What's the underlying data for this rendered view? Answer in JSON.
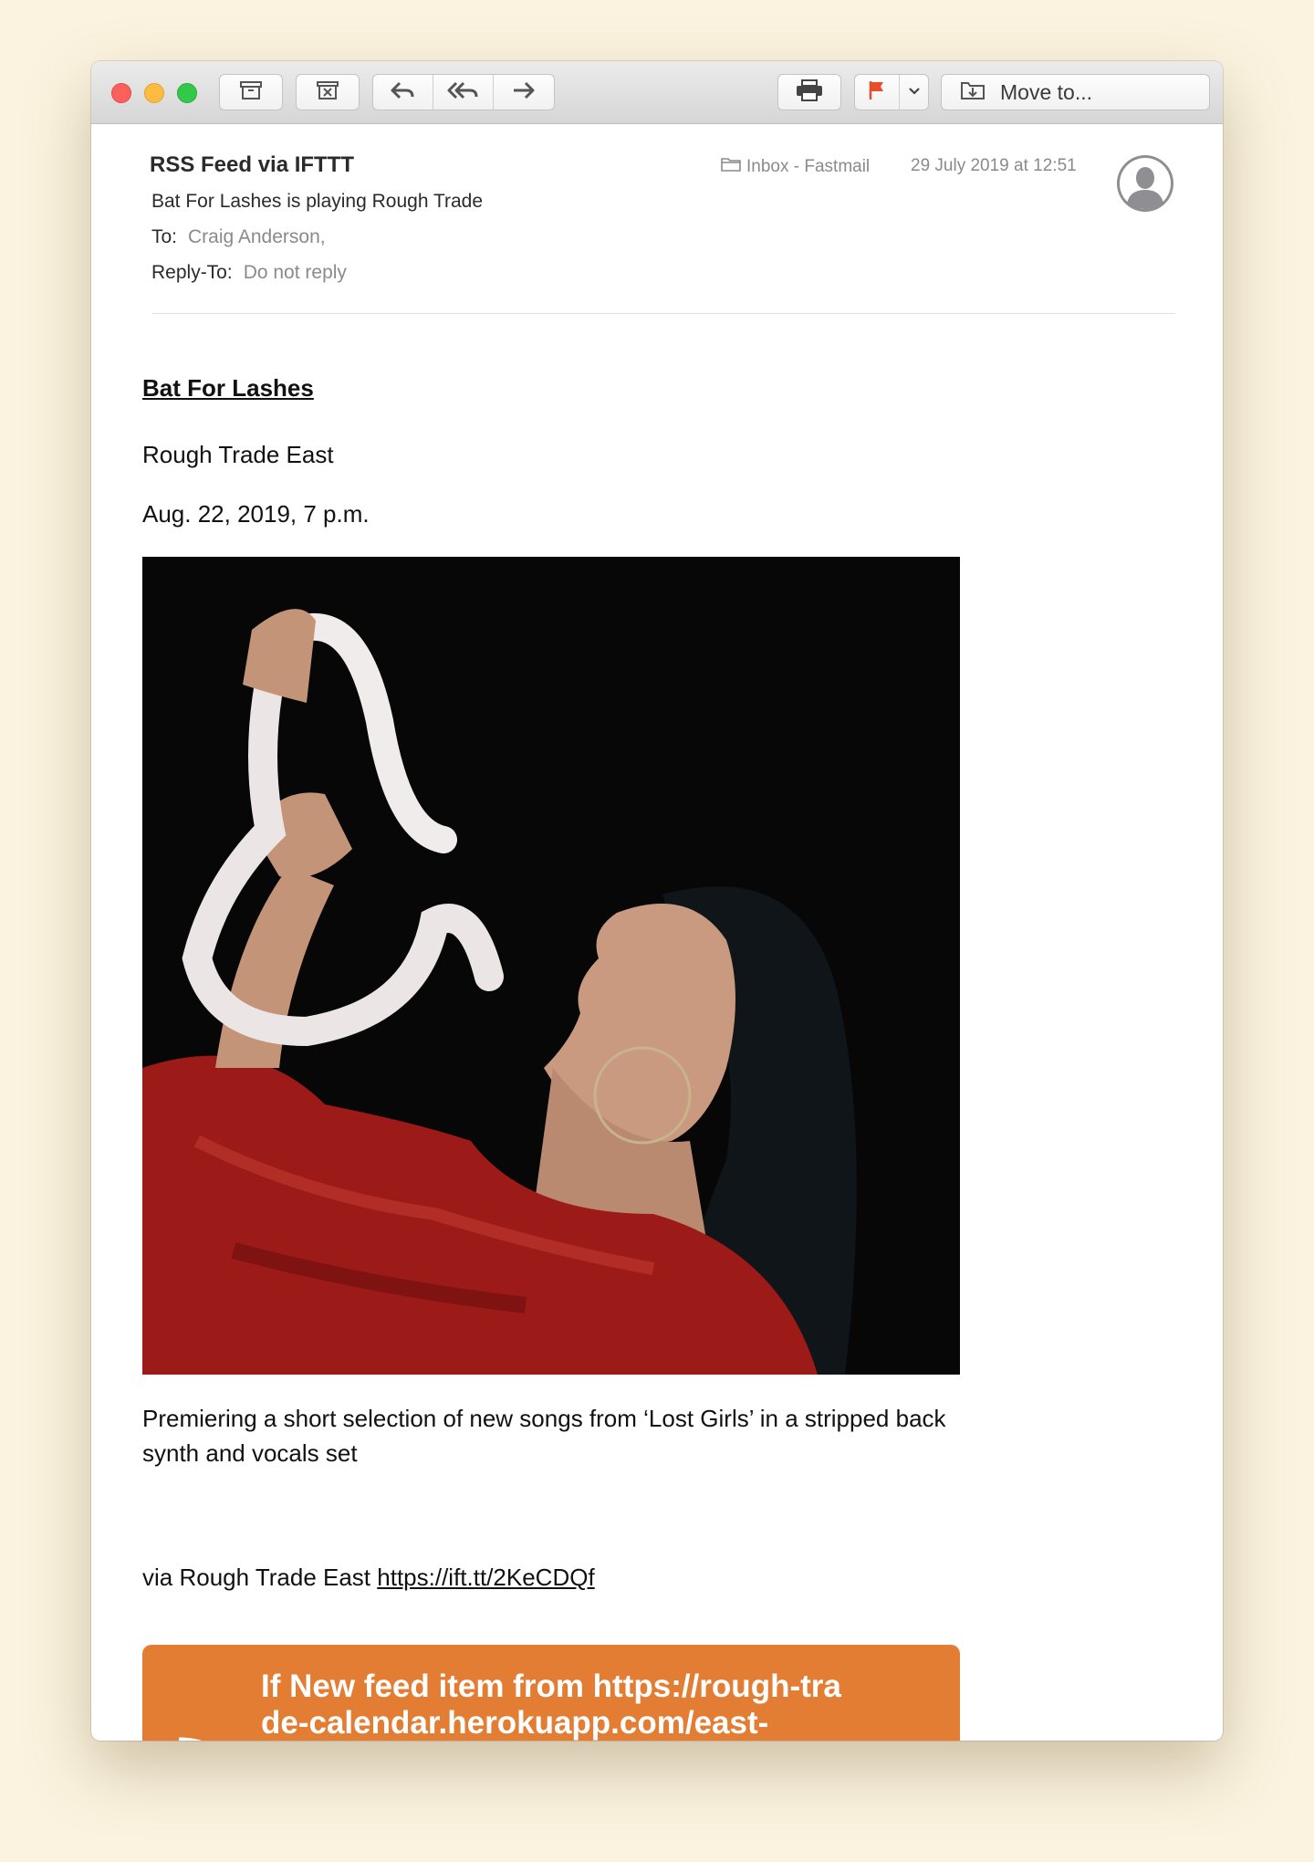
{
  "toolbar": {
    "archive_icon": "archive-icon",
    "delete_icon": "trash-icon",
    "reply_icon": "reply-icon",
    "reply_all_icon": "reply-all-icon",
    "forward_icon": "forward-icon",
    "print_icon": "print-icon",
    "flag_icon": "flag-icon",
    "flag_color": "#e74c2b",
    "move_label": "Move to..."
  },
  "header": {
    "sender": "RSS Feed via IFTTT",
    "subject": "Bat For Lashes is playing Rough Trade",
    "to_label": "To:",
    "to_value": "Craig Anderson,",
    "reply_to_label": "Reply-To:",
    "reply_to_value": "Do not reply",
    "mailbox": "Inbox - Fastmail",
    "date": "29 July 2019 at 12:51"
  },
  "message": {
    "artist": "Bat For Lashes",
    "venue": "Rough Trade East",
    "event_date": "Aug. 22, 2019, 7 p.m.",
    "description": "Premiering a short selection of new songs from ‘Lost Girls’ in a stripped back synth and vocals set",
    "via_prefix": "via Rough Trade East ",
    "via_link": "https://ift.tt/2KeCDQf",
    "banner_text": "If New feed item from https://rough-trade-calendar.herokuapp.com/east-",
    "banner_color": "#e27d33"
  }
}
